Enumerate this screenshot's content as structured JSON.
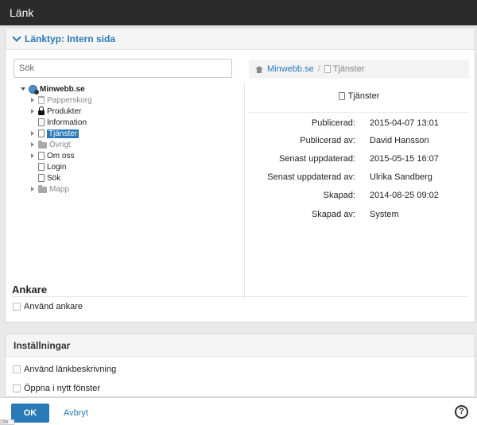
{
  "window": {
    "title": "Länk"
  },
  "link_type": {
    "label": "Länktyp: Intern sida"
  },
  "search": {
    "placeholder": "Sök"
  },
  "tree": {
    "root": "Minwebb.se",
    "items": [
      {
        "label": "Papperskorg",
        "icon": "trash-icon"
      },
      {
        "label": "Produkter",
        "icon": "lock-icon"
      },
      {
        "label": "Information",
        "icon": "page-icon"
      },
      {
        "label": "Tjänster",
        "icon": "page-icon",
        "selected": true
      },
      {
        "label": "Övrigt",
        "icon": "folder-icon"
      },
      {
        "label": "Om oss",
        "icon": "page-icon"
      },
      {
        "label": "Login",
        "icon": "page-icon"
      },
      {
        "label": "Sök",
        "icon": "page-icon"
      },
      {
        "label": "Mapp",
        "icon": "folder-icon"
      }
    ]
  },
  "breadcrumb": {
    "root": "Minwebb.se",
    "separator": "/",
    "current": "Tjänster"
  },
  "details": {
    "title": "Tjänster",
    "rows": [
      {
        "label": "Publicerad:",
        "value": "2015-04-07 13:01"
      },
      {
        "label": "Publicerad av:",
        "value": "David Hansson"
      },
      {
        "label": "Senast uppdaterad:",
        "value": "2015-05-15 16:07"
      },
      {
        "label": "Senast uppdaterad av:",
        "value": "Ulrika Sandberg"
      },
      {
        "label": "Skapad:",
        "value": "2014-08-25 09:02"
      },
      {
        "label": "Skapad av:",
        "value": "System"
      }
    ]
  },
  "anchor": {
    "heading": "Ankare",
    "use_anchor_label": "Använd ankare"
  },
  "settings": {
    "heading": "Inställningar",
    "use_description_label": "Använd länkbeskrivning",
    "open_new_window_label": "Öppna i nytt fönster"
  },
  "footer": {
    "ok_label": "OK",
    "cancel_label": "Avbryt",
    "help_label": "?",
    "version_tag": "20#"
  }
}
